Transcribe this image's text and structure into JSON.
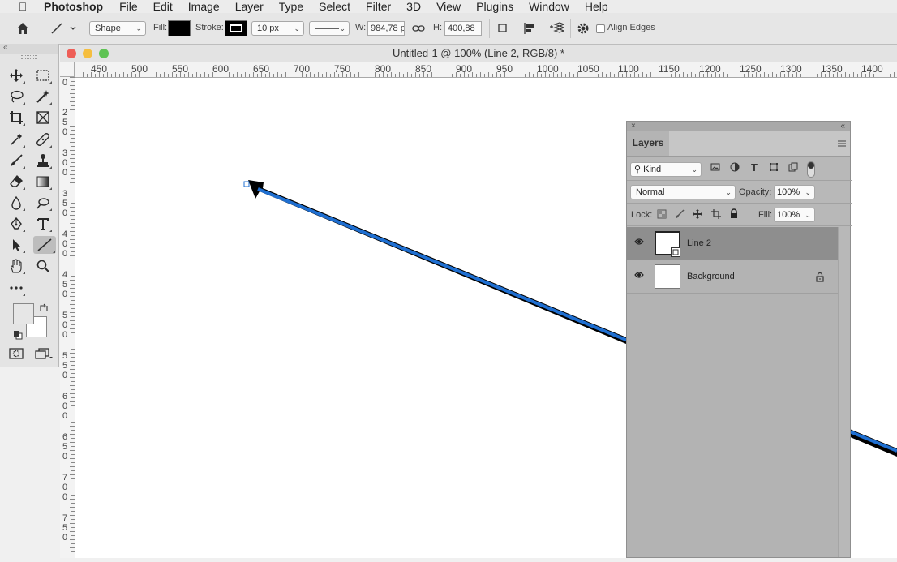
{
  "menubar": {
    "app": "Photoshop",
    "items": [
      "File",
      "Edit",
      "Image",
      "Layer",
      "Type",
      "Select",
      "Filter",
      "3D",
      "View",
      "Plugins",
      "Window",
      "Help"
    ]
  },
  "options": {
    "mode": "Shape",
    "fill_label": "Fill:",
    "stroke_label": "Stroke:",
    "stroke_width": "10 px",
    "w_label": "W:",
    "w_value": "984,78 p",
    "h_label": "H:",
    "h_value": "400,88",
    "align_edges": "Align Edges"
  },
  "document": {
    "title": "Untitled-1 @ 100% (Line 2, RGB/8) *",
    "h_ruler": [
      "450",
      "500",
      "550",
      "600",
      "650",
      "700",
      "750",
      "800",
      "850",
      "900",
      "950",
      "1000",
      "1050",
      "1100",
      "1150",
      "1200",
      "1250",
      "1300",
      "1350",
      "1400"
    ],
    "v_ruler": [
      "0",
      "250",
      "300",
      "350",
      "400",
      "450",
      "500",
      "550",
      "600",
      "650",
      "700",
      "750"
    ]
  },
  "layers_panel": {
    "tab": "Layers",
    "filter_kind": "Kind",
    "blend_mode": "Normal",
    "opacity_label": "Opacity:",
    "opacity_value": "100%",
    "lock_label": "Lock:",
    "fill_label": "Fill:",
    "fill_value": "100%",
    "layers": [
      {
        "name": "Line 2",
        "selected": true
      },
      {
        "name": "Background",
        "selected": false
      }
    ]
  },
  "colors": {
    "stroke_blue": "#1f6fd1",
    "fill_swatch": "#000000",
    "foreground": "#e6e6e6",
    "background": "#ffffff"
  }
}
